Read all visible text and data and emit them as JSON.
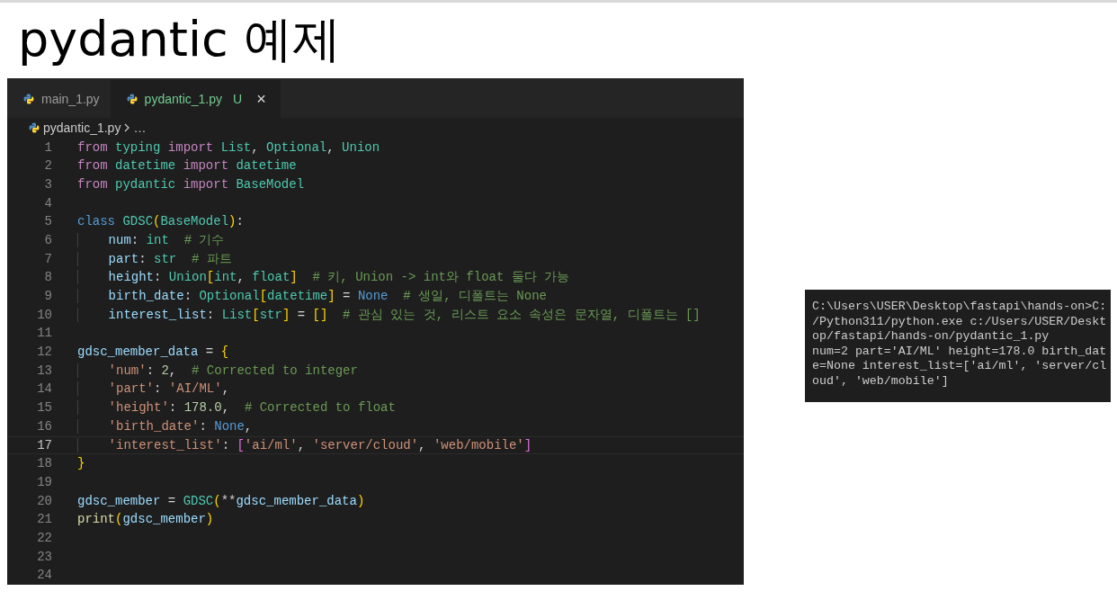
{
  "slide_title": "pydantic 예제",
  "editor": {
    "tabs": [
      {
        "label": "main_1.py",
        "selected": false
      },
      {
        "label": "pydantic_1.py",
        "selected": true,
        "git_status": "U",
        "close": "×"
      }
    ],
    "breadcrumb": [
      "pydantic_1.py",
      "…"
    ],
    "lines": [
      {
        "number": "1",
        "current": false,
        "tokens": [
          {
            "kind": "keyword",
            "text": "from "
          },
          {
            "kind": "type",
            "text": "typing "
          },
          {
            "kind": "keyword",
            "text": "import "
          },
          {
            "kind": "type",
            "text": "List"
          },
          {
            "kind": "plain",
            "text": ", "
          },
          {
            "kind": "type",
            "text": "Optional"
          },
          {
            "kind": "plain",
            "text": ", "
          },
          {
            "kind": "type",
            "text": "Union"
          }
        ]
      },
      {
        "number": "2",
        "current": false,
        "tokens": [
          {
            "kind": "keyword",
            "text": "from "
          },
          {
            "kind": "type",
            "text": "datetime "
          },
          {
            "kind": "keyword",
            "text": "import "
          },
          {
            "kind": "type",
            "text": "datetime"
          }
        ]
      },
      {
        "number": "3",
        "current": false,
        "tokens": [
          {
            "kind": "keyword",
            "text": "from "
          },
          {
            "kind": "type",
            "text": "pydantic "
          },
          {
            "kind": "keyword",
            "text": "import "
          },
          {
            "kind": "type",
            "text": "BaseModel"
          }
        ]
      },
      {
        "number": "4",
        "current": false
      },
      {
        "number": "5",
        "current": false,
        "tokens": [
          {
            "kind": "constant",
            "text": "class "
          },
          {
            "kind": "type",
            "text": "GDSC"
          },
          {
            "kind": "bracket",
            "text": "("
          },
          {
            "kind": "type",
            "text": "BaseModel"
          },
          {
            "kind": "bracket",
            "text": ")"
          },
          {
            "kind": "plain",
            "text": ":"
          }
        ]
      },
      {
        "number": "6",
        "current": false,
        "tokens": [
          {
            "kind": "variable",
            "text": "    num"
          },
          {
            "kind": "plain",
            "text": ": "
          },
          {
            "kind": "type",
            "text": "int  "
          },
          {
            "kind": "comment",
            "text": "# 기수"
          }
        ]
      },
      {
        "number": "7",
        "current": false,
        "tokens": [
          {
            "kind": "variable",
            "text": "    part"
          },
          {
            "kind": "plain",
            "text": ": "
          },
          {
            "kind": "type",
            "text": "str  "
          },
          {
            "kind": "comment",
            "text": "# 파트"
          }
        ]
      },
      {
        "number": "8",
        "current": false,
        "tokens": [
          {
            "kind": "variable",
            "text": "    height"
          },
          {
            "kind": "plain",
            "text": ": "
          },
          {
            "kind": "type",
            "text": "Union"
          },
          {
            "kind": "bracket",
            "text": "["
          },
          {
            "kind": "type",
            "text": "int"
          },
          {
            "kind": "plain",
            "text": ", "
          },
          {
            "kind": "type",
            "text": "float"
          },
          {
            "kind": "bracket",
            "text": "]  "
          },
          {
            "kind": "comment",
            "text": "# 키, Union -> int와 float 둘다 가능"
          }
        ]
      },
      {
        "number": "9",
        "current": false,
        "tokens": [
          {
            "kind": "variable",
            "text": "    birth_date"
          },
          {
            "kind": "plain",
            "text": ": "
          },
          {
            "kind": "type",
            "text": "Optional"
          },
          {
            "kind": "bracket",
            "text": "["
          },
          {
            "kind": "type",
            "text": "datetime"
          },
          {
            "kind": "bracket",
            "text": "]"
          },
          {
            "kind": "plain",
            "text": " = "
          },
          {
            "kind": "constant",
            "text": "None  "
          },
          {
            "kind": "comment",
            "text": "# 생일, 디폴트는 None"
          }
        ]
      },
      {
        "number": "10",
        "current": false,
        "tokens": [
          {
            "kind": "variable",
            "text": "    interest_list"
          },
          {
            "kind": "plain",
            "text": ": "
          },
          {
            "kind": "type",
            "text": "List"
          },
          {
            "kind": "bracket",
            "text": "["
          },
          {
            "kind": "type",
            "text": "str"
          },
          {
            "kind": "bracket",
            "text": "]"
          },
          {
            "kind": "plain",
            "text": " = "
          },
          {
            "kind": "bracket",
            "text": "[]  "
          },
          {
            "kind": "comment",
            "text": "# 관심 있는 것, 리스트 요소 속성은 문자열, 디폴트는 []"
          }
        ]
      },
      {
        "number": "11",
        "current": false
      },
      {
        "number": "12",
        "current": false,
        "tokens": [
          {
            "kind": "variable",
            "text": "gdsc_member_data"
          },
          {
            "kind": "plain",
            "text": " = "
          },
          {
            "kind": "bracket",
            "text": "{"
          }
        ]
      },
      {
        "number": "13",
        "current": false,
        "tokens": [
          {
            "kind": "string",
            "text": "    'num'"
          },
          {
            "kind": "plain",
            "text": ": "
          },
          {
            "kind": "number",
            "text": "2"
          },
          {
            "kind": "plain",
            "text": ",  "
          },
          {
            "kind": "comment",
            "text": "# Corrected to integer"
          }
        ]
      },
      {
        "number": "14",
        "current": false,
        "tokens": [
          {
            "kind": "string",
            "text": "    'part'"
          },
          {
            "kind": "plain",
            "text": ": "
          },
          {
            "kind": "string",
            "text": "'AI/ML'"
          },
          {
            "kind": "plain",
            "text": ","
          }
        ]
      },
      {
        "number": "15",
        "current": false,
        "tokens": [
          {
            "kind": "string",
            "text": "    'height'"
          },
          {
            "kind": "plain",
            "text": ": "
          },
          {
            "kind": "number",
            "text": "178.0"
          },
          {
            "kind": "plain",
            "text": ",  "
          },
          {
            "kind": "comment",
            "text": "# Corrected to float"
          }
        ]
      },
      {
        "number": "16",
        "current": false,
        "tokens": [
          {
            "kind": "string",
            "text": "    'birth_date'"
          },
          {
            "kind": "plain",
            "text": ": "
          },
          {
            "kind": "constant",
            "text": "None"
          },
          {
            "kind": "plain",
            "text": ","
          }
        ]
      },
      {
        "number": "17",
        "current": true,
        "tokens": [
          {
            "kind": "string",
            "text": "    'interest_list'"
          },
          {
            "kind": "plain",
            "text": ": "
          },
          {
            "kind": "bracket2",
            "text": "["
          },
          {
            "kind": "string",
            "text": "'ai/ml'"
          },
          {
            "kind": "plain",
            "text": ", "
          },
          {
            "kind": "string",
            "text": "'server/cloud'"
          },
          {
            "kind": "plain",
            "text": ", "
          },
          {
            "kind": "string",
            "text": "'web/mobile'"
          },
          {
            "kind": "bracket2",
            "text": "]"
          }
        ]
      },
      {
        "number": "18",
        "current": false,
        "tokens": [
          {
            "kind": "bracket",
            "text": "}"
          }
        ]
      },
      {
        "number": "19",
        "current": false
      },
      {
        "number": "20",
        "current": false,
        "tokens": [
          {
            "kind": "variable",
            "text": "gdsc_member"
          },
          {
            "kind": "plain",
            "text": " = "
          },
          {
            "kind": "type",
            "text": "GDSC"
          },
          {
            "kind": "bracket",
            "text": "("
          },
          {
            "kind": "plain",
            "text": "**"
          },
          {
            "kind": "variable",
            "text": "gdsc_member_data"
          },
          {
            "kind": "bracket",
            "text": ")"
          }
        ]
      },
      {
        "number": "21",
        "current": false,
        "tokens": [
          {
            "kind": "function",
            "text": "print"
          },
          {
            "kind": "bracket",
            "text": "("
          },
          {
            "kind": "variable",
            "text": "gdsc_member"
          },
          {
            "kind": "bracket",
            "text": ")"
          }
        ]
      },
      {
        "number": "22",
        "current": false
      },
      {
        "number": "23",
        "current": false
      },
      {
        "number": "24",
        "current": false
      }
    ]
  },
  "terminal": {
    "lines": [
      "C:\\Users\\USER\\Desktop\\fastapi\\hands-on>C:",
      "/Python311/python.exe c:/Users/USER/Deskt",
      "op/fastapi/hands-on/pydantic_1.py",
      "num=2 part='AI/ML' height=178.0 birth_dat",
      "e=None interest_list=['ai/ml', 'server/cl",
      "oud', 'web/mobile']"
    ]
  }
}
